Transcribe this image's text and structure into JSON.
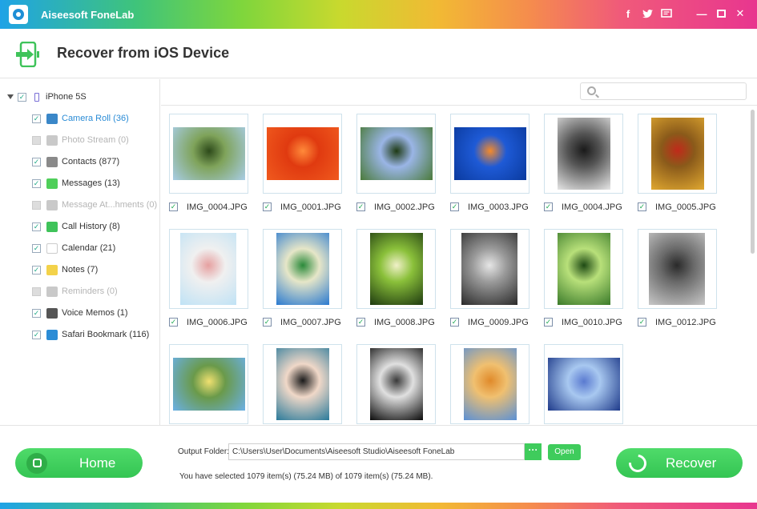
{
  "window": {
    "title": "Aiseesoft FoneLab",
    "controls": {
      "facebook": "f",
      "minimize": "—",
      "maximize": "☐",
      "close": "✕"
    }
  },
  "header": {
    "title": "Recover from iOS Device"
  },
  "sidebar": {
    "device": "iPhone 5S",
    "items": [
      {
        "label": "Camera Roll (36)",
        "icon": "camera-icon",
        "color": "#3a87c8",
        "checked": true,
        "state": "active"
      },
      {
        "label": "Photo Stream (0)",
        "icon": "photo-stream-icon",
        "color": "#c9c9c9",
        "checked": false,
        "state": "dim"
      },
      {
        "label": "Contacts (877)",
        "icon": "contacts-icon",
        "color": "#8a8a8a",
        "checked": true,
        "state": "normal"
      },
      {
        "label": "Messages (13)",
        "icon": "messages-icon",
        "color": "#4fcf5a",
        "checked": true,
        "state": "normal"
      },
      {
        "label": "Message At...hments (0)",
        "icon": "attachment-icon",
        "color": "#c9c9c9",
        "checked": false,
        "state": "dim"
      },
      {
        "label": "Call History (8)",
        "icon": "phone-icon",
        "color": "#3fc35a",
        "checked": true,
        "state": "normal"
      },
      {
        "label": "Calendar (21)",
        "icon": "calendar-icon",
        "color": "#ffffff",
        "checked": true,
        "state": "normal"
      },
      {
        "label": "Notes (7)",
        "icon": "notes-icon",
        "color": "#f3d24a",
        "checked": true,
        "state": "normal"
      },
      {
        "label": "Reminders (0)",
        "icon": "reminders-icon",
        "color": "#c9c9c9",
        "checked": false,
        "state": "dim"
      },
      {
        "label": "Voice Memos (1)",
        "icon": "voice-memo-icon",
        "color": "#555555",
        "checked": true,
        "state": "normal"
      },
      {
        "label": "Safari Bookmark (116)",
        "icon": "safari-icon",
        "color": "#2b8cd6",
        "checked": true,
        "state": "normal"
      }
    ]
  },
  "search": {
    "placeholder": ""
  },
  "photos": [
    {
      "name": "IMG_0004.JPG",
      "palette": [
        "#a8cde6",
        "#7fa35a",
        "#2d4a1a"
      ]
    },
    {
      "name": "IMG_0001.JPG",
      "palette": [
        "#f05a1e",
        "#e03a10",
        "#ff8a3a"
      ]
    },
    {
      "name": "IMG_0002.JPG",
      "palette": [
        "#4a7a3a",
        "#9ab5e6",
        "#1e3a14"
      ]
    },
    {
      "name": "IMG_0003.JPG",
      "palette": [
        "#0a3a9e",
        "#1e5ad6",
        "#f58a2a"
      ]
    },
    {
      "name": "IMG_0004.JPG",
      "palette": [
        "#e6e6e6",
        "#555555",
        "#1a1a1a"
      ]
    },
    {
      "name": "IMG_0005.JPG",
      "palette": [
        "#e0a830",
        "#8a5a1a",
        "#c02a1a"
      ]
    },
    {
      "name": "IMG_0006.JPG",
      "palette": [
        "#bfe2f5",
        "#f0f0f0",
        "#e6a0a0"
      ]
    },
    {
      "name": "IMG_0007.JPG",
      "palette": [
        "#2a7ad0",
        "#e6e6c8",
        "#2a8a3a"
      ]
    },
    {
      "name": "IMG_0008.JPG",
      "palette": [
        "#1e3a10",
        "#8ac03a",
        "#f0f0c8"
      ]
    },
    {
      "name": "IMG_0009.JPG",
      "palette": [
        "#2a2a2a",
        "#9a9a9a",
        "#e6e6e6"
      ]
    },
    {
      "name": "IMG_0010.JPG",
      "palette": [
        "#3a7a2a",
        "#b8e07a",
        "#1e4a14"
      ]
    },
    {
      "name": "IMG_0012.JPG",
      "palette": [
        "#c8c8c8",
        "#6a6a6a",
        "#2a2a2a"
      ]
    },
    {
      "name": "",
      "palette": [
        "#6ab0e6",
        "#6a9a4a",
        "#f0e070"
      ]
    },
    {
      "name": "",
      "palette": [
        "#2a7a9a",
        "#f0d8c8",
        "#1a1a1a"
      ]
    },
    {
      "name": "",
      "palette": [
        "#0a0a0a",
        "#e0e0e0",
        "#3a3a3a"
      ]
    },
    {
      "name": "",
      "palette": [
        "#5a90d6",
        "#f0c070",
        "#e08a2a"
      ]
    },
    {
      "name": "",
      "palette": [
        "#1e3a8a",
        "#a8c8f0",
        "#5a7ad0"
      ]
    }
  ],
  "footer": {
    "home_label": "Home",
    "output_label": "Output Folder:",
    "output_path": "C:\\Users\\User\\Documents\\Aiseesoft Studio\\Aiseesoft FoneLab",
    "browse_label": "···",
    "open_label": "Open",
    "status": "You have selected 1079 item(s) (75.24 MB) of 1079 item(s) (75.24 MB).",
    "recover_label": "Recover"
  },
  "colors": {
    "accent_green": "#3fcc5c",
    "active_blue": "#2b8cd6"
  }
}
